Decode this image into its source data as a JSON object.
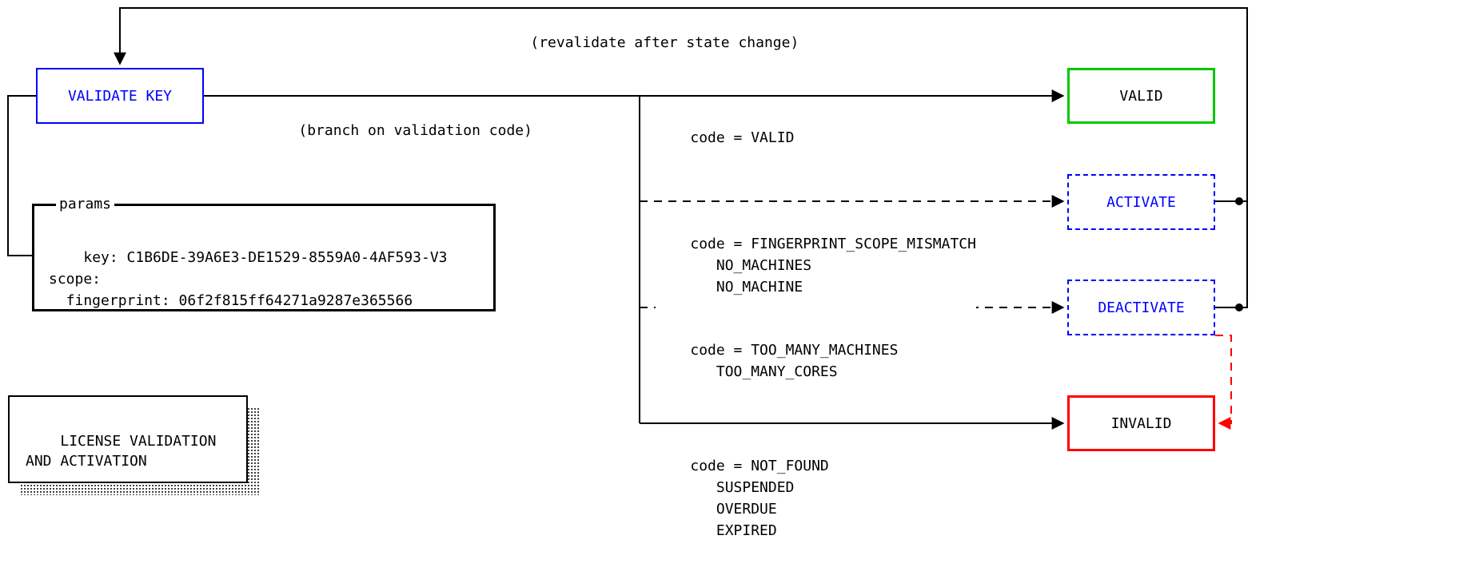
{
  "nodes": {
    "validate_key": "VALIDATE KEY",
    "valid": "VALID",
    "activate": "ACTIVATE",
    "deactivate": "DEACTIVATE",
    "invalid": "INVALID"
  },
  "edge_labels": {
    "revalidate": "(revalidate after state change)",
    "branch": "(branch on validation code)"
  },
  "branch_codes": {
    "valid": "code = VALID",
    "activate": "code = FINGERPRINT_SCOPE_MISMATCH\n       NO_MACHINES\n       NO_MACHINE",
    "deactivate": "code = TOO_MANY_MACHINES\n       TOO_MANY_CORES",
    "invalid": "code = NOT_FOUND\n       SUSPENDED\n       OVERDUE\n       EXPIRED"
  },
  "params": {
    "legend": "params",
    "body": "key: C1B6DE-39A6E3-DE1529-8559A0-4AF593-V3\nscope:\n  fingerprint: 06f2f815ff64271a9287e365566"
  },
  "title": "LICENSE VALIDATION\nAND ACTIVATION",
  "colors": {
    "blue": "#0000ff",
    "green": "#00c800",
    "red": "#ff0000",
    "black": "#000000"
  }
}
